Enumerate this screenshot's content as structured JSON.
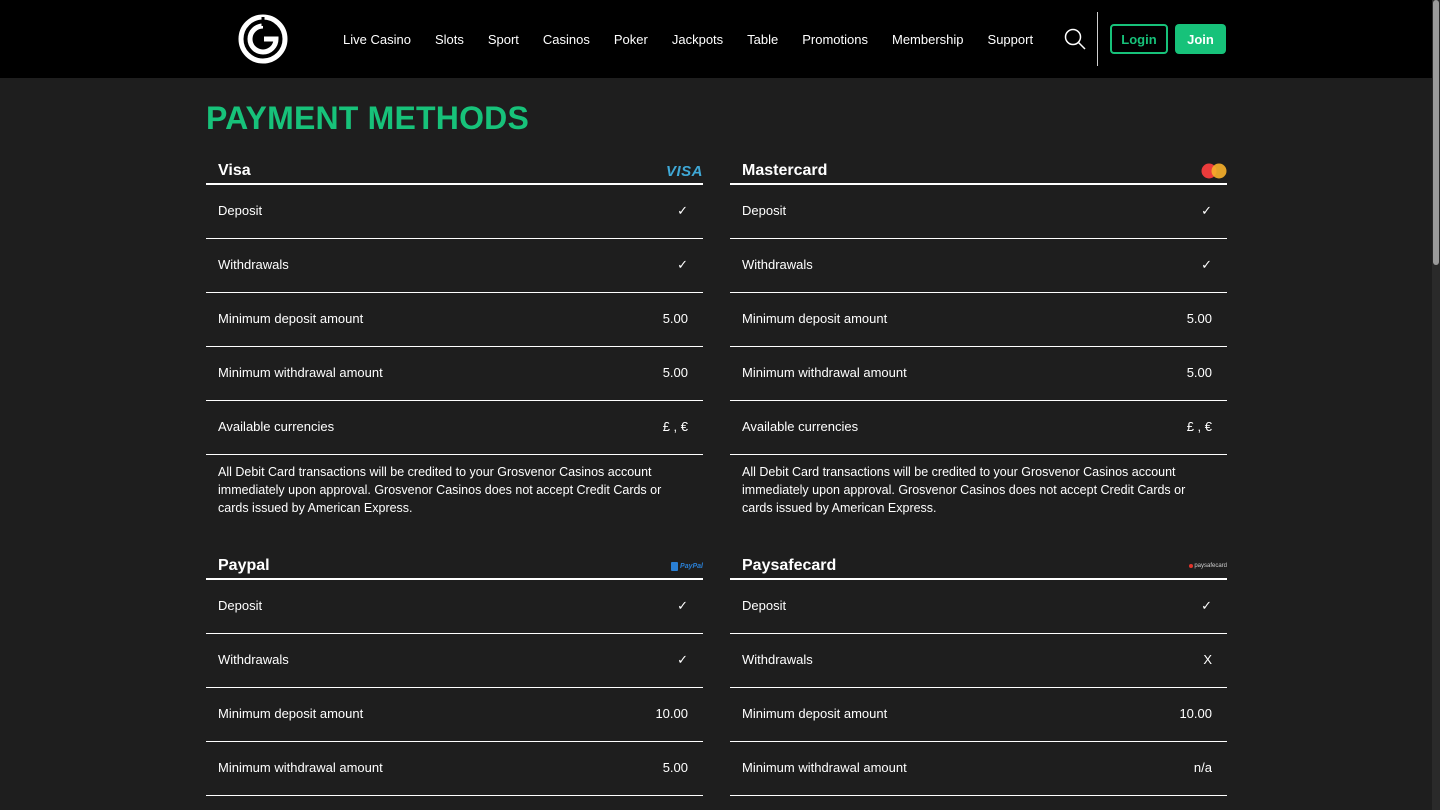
{
  "nav": {
    "items": [
      "Live Casino",
      "Slots",
      "Sport",
      "Casinos",
      "Poker",
      "Jackpots",
      "Table",
      "Promotions",
      "Membership",
      "Support"
    ]
  },
  "header": {
    "login_label": "Login",
    "join_label": "Join"
  },
  "page": {
    "title": "PAYMENT METHODS"
  },
  "colors": {
    "brand_green": "#17c27a",
    "background": "#1e1e1e",
    "header_bg": "#000000"
  },
  "cards": [
    {
      "name": "Visa",
      "logo_text": "VISA",
      "rows": [
        {
          "label": "Deposit",
          "value": "✓"
        },
        {
          "label": "Withdrawals",
          "value": "✓"
        },
        {
          "label": "Minimum deposit amount",
          "value": "5.00"
        },
        {
          "label": "Minimum withdrawal amount",
          "value": "5.00"
        },
        {
          "label": "Available currencies",
          "value": "£ , €"
        }
      ],
      "note": "All Debit Card transactions will be credited to your Grosvenor Casinos account immediately upon approval. Grosvenor Casinos does not accept Credit Cards or cards issued by American Express."
    },
    {
      "name": "Mastercard",
      "rows": [
        {
          "label": "Deposit",
          "value": "✓"
        },
        {
          "label": "Withdrawals",
          "value": "✓"
        },
        {
          "label": "Minimum deposit amount",
          "value": "5.00"
        },
        {
          "label": "Minimum withdrawal amount",
          "value": "5.00"
        },
        {
          "label": "Available currencies",
          "value": "£ , €"
        }
      ],
      "note": "All Debit Card transactions will be credited to your Grosvenor Casinos account immediately upon approval. Grosvenor Casinos does not accept Credit Cards or cards issued by American Express."
    },
    {
      "name": "Paypal",
      "logo_text": "PayPal",
      "rows": [
        {
          "label": "Deposit",
          "value": "✓"
        },
        {
          "label": "Withdrawals",
          "value": "✓"
        },
        {
          "label": "Minimum deposit amount",
          "value": "10.00"
        },
        {
          "label": "Minimum withdrawal amount",
          "value": "5.00"
        }
      ]
    },
    {
      "name": "Paysafecard",
      "logo_text": "paysafecard",
      "rows": [
        {
          "label": "Deposit",
          "value": "✓"
        },
        {
          "label": "Withdrawals",
          "value": "X"
        },
        {
          "label": "Minimum deposit amount",
          "value": "10.00"
        },
        {
          "label": "Minimum withdrawal amount",
          "value": "n/a"
        }
      ]
    }
  ]
}
